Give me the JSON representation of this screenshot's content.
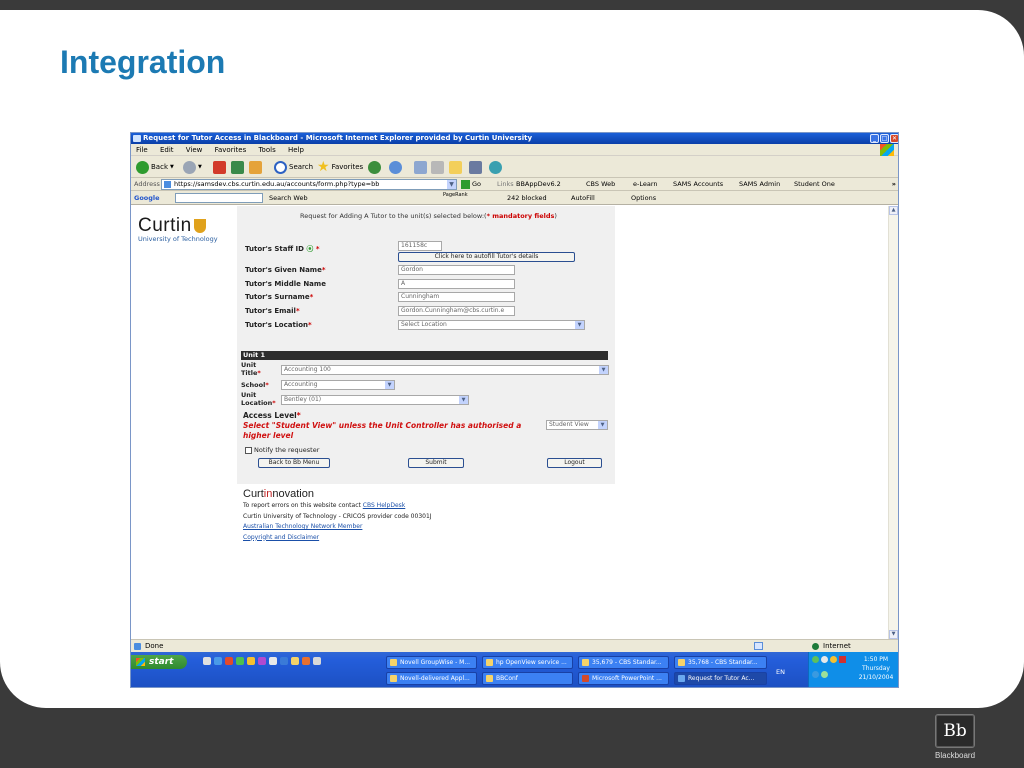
{
  "slide": {
    "title": "Integration",
    "brand_logo_text": "Bb",
    "brand_name": "Blackboard"
  },
  "window": {
    "title": "Request for Tutor Access in Blackboard - Microsoft Internet Explorer provided by Curtin University",
    "menu": [
      "File",
      "Edit",
      "View",
      "Favorites",
      "Tools",
      "Help"
    ],
    "toolbar": {
      "back_label": "Back",
      "search_label": "Search",
      "favorites_label": "Favorites"
    },
    "address": {
      "label": "Address",
      "url": "https://samsdev.cbs.curtin.edu.au/accounts/form.php?type=bb",
      "go_label": "Go",
      "links_label": "Links",
      "links": [
        "BBAppDev6.2",
        "CBS Web",
        "e-Learn",
        "SAMS Accounts",
        "SAMS Admin",
        "Student One"
      ]
    },
    "google_bar": {
      "logo": "Google",
      "search_web": "Search Web",
      "pagerank": "PageRank",
      "blocked": "242 blocked",
      "autofill": "AutoFill",
      "options": "Options"
    },
    "status": {
      "text": "Done",
      "zone": "Internet"
    }
  },
  "page": {
    "logo_name": "Curtin",
    "logo_sub": "University of Technology",
    "form_heading": "Request for Adding A Tutor to the unit(s) selected below:(",
    "form_heading_mand": "* mandatory fields",
    "form_heading_end": ")",
    "fields": {
      "staff_id_label": "Tutor's Staff ID",
      "staff_id_value": "161158c",
      "autofill_button": "Click here to autofill Tutor's details",
      "given_name_label": "Tutor's Given Name",
      "given_name_value": "Gordon",
      "middle_name_label": "Tutor's Middle Name",
      "middle_name_value": "A",
      "surname_label": "Tutor's Surname",
      "surname_value": "Cunningham",
      "email_label": "Tutor's Email",
      "email_value": "Gordon.Cunningham@cbs.curtin.e",
      "location_label": "Tutor's Location",
      "location_value": "Select Location"
    },
    "unit": {
      "header": "Unit 1",
      "title_label_1": "Unit",
      "title_label_2": "Title",
      "title_value": "Accounting 100",
      "school_label": "School",
      "school_value": "Accounting",
      "location_label_1": "Unit",
      "location_label_2": "Location",
      "location_value": "Bentley (01)"
    },
    "access_level_label": "Access Level",
    "access_level_value": "Student View",
    "warning": "Select \"Student View\" unless the Unit Controller has authorised a higher level",
    "notify_label": "Notify the requester",
    "buttons": {
      "back": "Back to Bb Menu",
      "submit": "Submit",
      "logout": "Logout"
    },
    "footer": {
      "brand_a": "Curt",
      "brand_b": "in",
      "brand_c": "novation",
      "report_text": "To report errors on this website contact ",
      "report_link": "CBS HelpDesk",
      "cricos": "Curtin University of Technology - CRICOS provider code 00301J",
      "atn_link": "Australian Technology Network Member",
      "copyright_link": "Copyright and Disclaimer"
    }
  },
  "taskbar": {
    "start": "start",
    "tasks": [
      "Novell GroupWise - M...",
      "hp OpenView service ...",
      "35,679 - CBS Standar...",
      "35,768 - CBS Standar...",
      "Novell-delivered Appl...",
      "BBConf",
      "Microsoft PowerPoint ...",
      "Request for Tutor Ac..."
    ],
    "lang": "EN",
    "time": "1:50 PM",
    "day": "Thursday",
    "date": "21/10/2004"
  }
}
